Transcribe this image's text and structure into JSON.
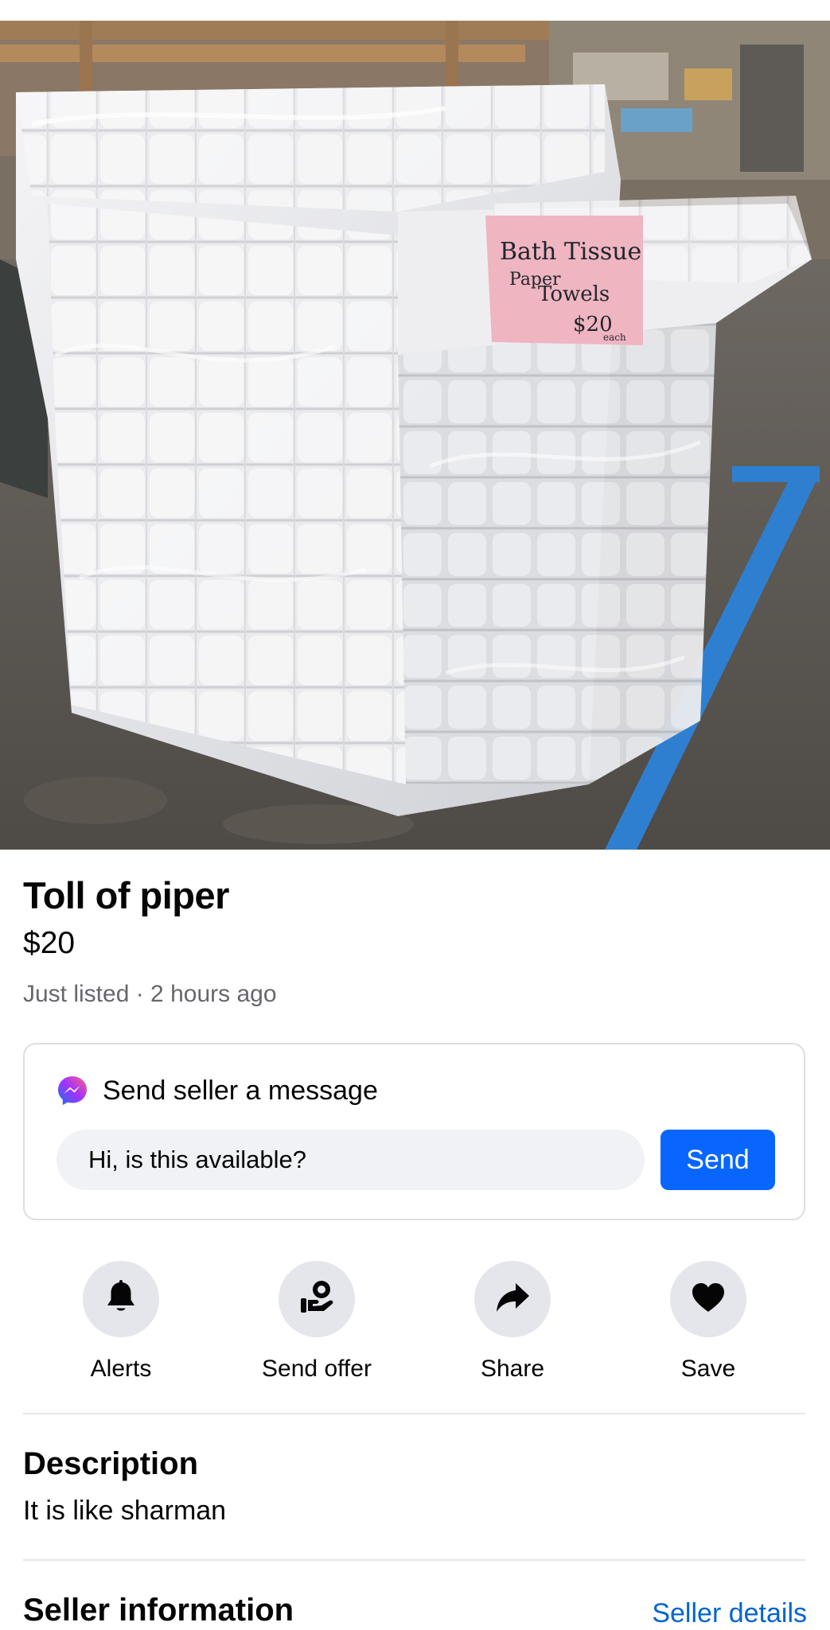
{
  "listing": {
    "title": "Toll of piper",
    "price": "$20",
    "listed": "Just listed · 2 hours ago",
    "photo": {
      "sign_line1": "Bath Tissue",
      "sign_line2": "Paper",
      "sign_line3": "Towels",
      "sign_line4": "$20",
      "sign_line5": "each"
    }
  },
  "message": {
    "heading": "Send seller a message",
    "input_value": "Hi, is this available?",
    "send_label": "Send"
  },
  "actions": [
    {
      "label": "Alerts",
      "icon": "bell-icon"
    },
    {
      "label": "Send offer",
      "icon": "offer-icon"
    },
    {
      "label": "Share",
      "icon": "share-icon"
    },
    {
      "label": "Save",
      "icon": "heart-icon"
    }
  ],
  "description": {
    "heading": "Description",
    "text": "It is like sharman"
  },
  "seller": {
    "heading": "Seller information",
    "link": "Seller details"
  },
  "colors": {
    "accent": "#0866ff",
    "link": "#0064d1",
    "secondary_text": "#65676b",
    "pill_background": "#f0f2f5",
    "icon_circle": "#e4e6eb"
  }
}
